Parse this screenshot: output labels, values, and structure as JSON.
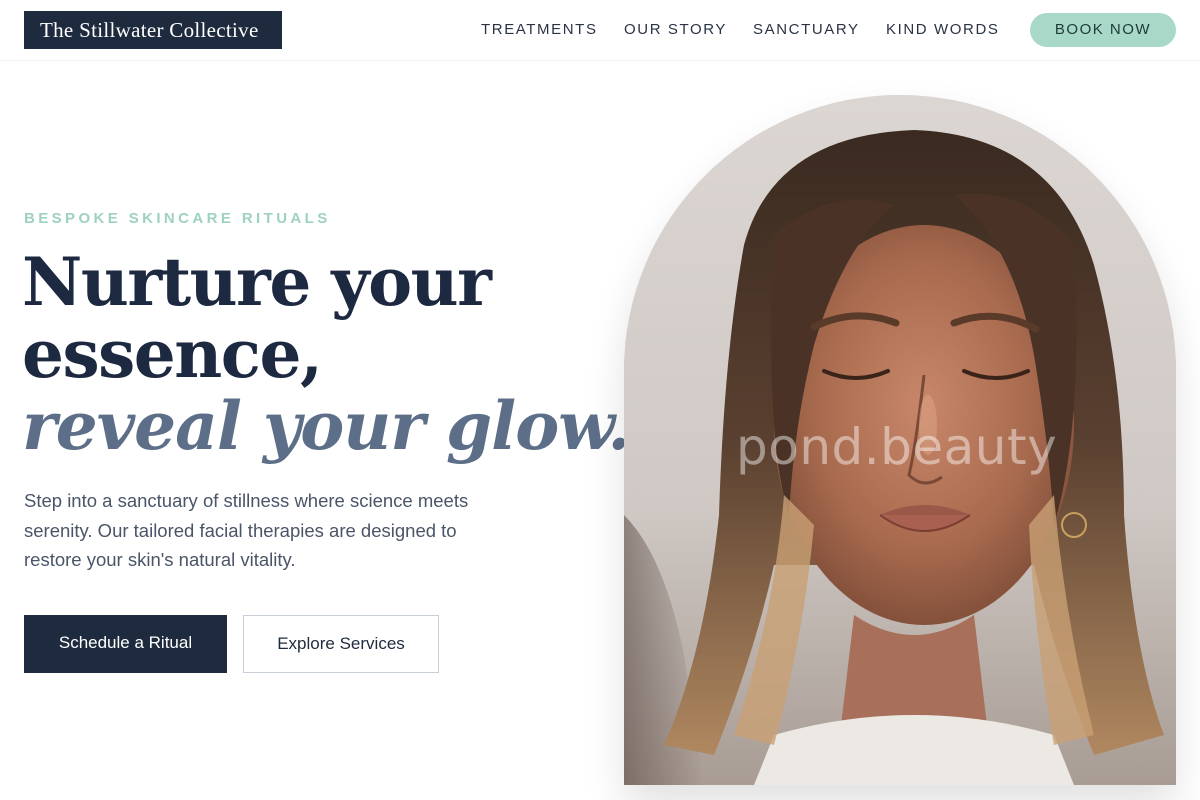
{
  "brand": {
    "name": "The Stillwater Collective"
  },
  "nav": {
    "items": [
      {
        "label": "TREATMENTS"
      },
      {
        "label": "OUR STORY"
      },
      {
        "label": "SANCTUARY"
      },
      {
        "label": "KIND WORDS"
      }
    ],
    "cta_label": "BOOK NOW"
  },
  "hero": {
    "eyebrow": "BESPOKE SKINCARE RITUALS",
    "headline_line1": "Nurture your",
    "headline_line2": "essence,",
    "headline_accent": "reveal your glow.",
    "description": "Step into a sanctuary of stillness where science meets serenity. Our tailored facial therapies are designed to restore your skin's natural vitality.",
    "primary_button": "Schedule a Ritual",
    "secondary_button": "Explore Services"
  },
  "image": {
    "watermark": "pond.beauty",
    "subject": "portrait-woman-eyes-closed"
  },
  "colors": {
    "navy": "#1e2a3e",
    "mint": "#a8d8c8",
    "eyebrow_mint": "#9fd1bf",
    "accent_slate": "#5d6f88"
  }
}
